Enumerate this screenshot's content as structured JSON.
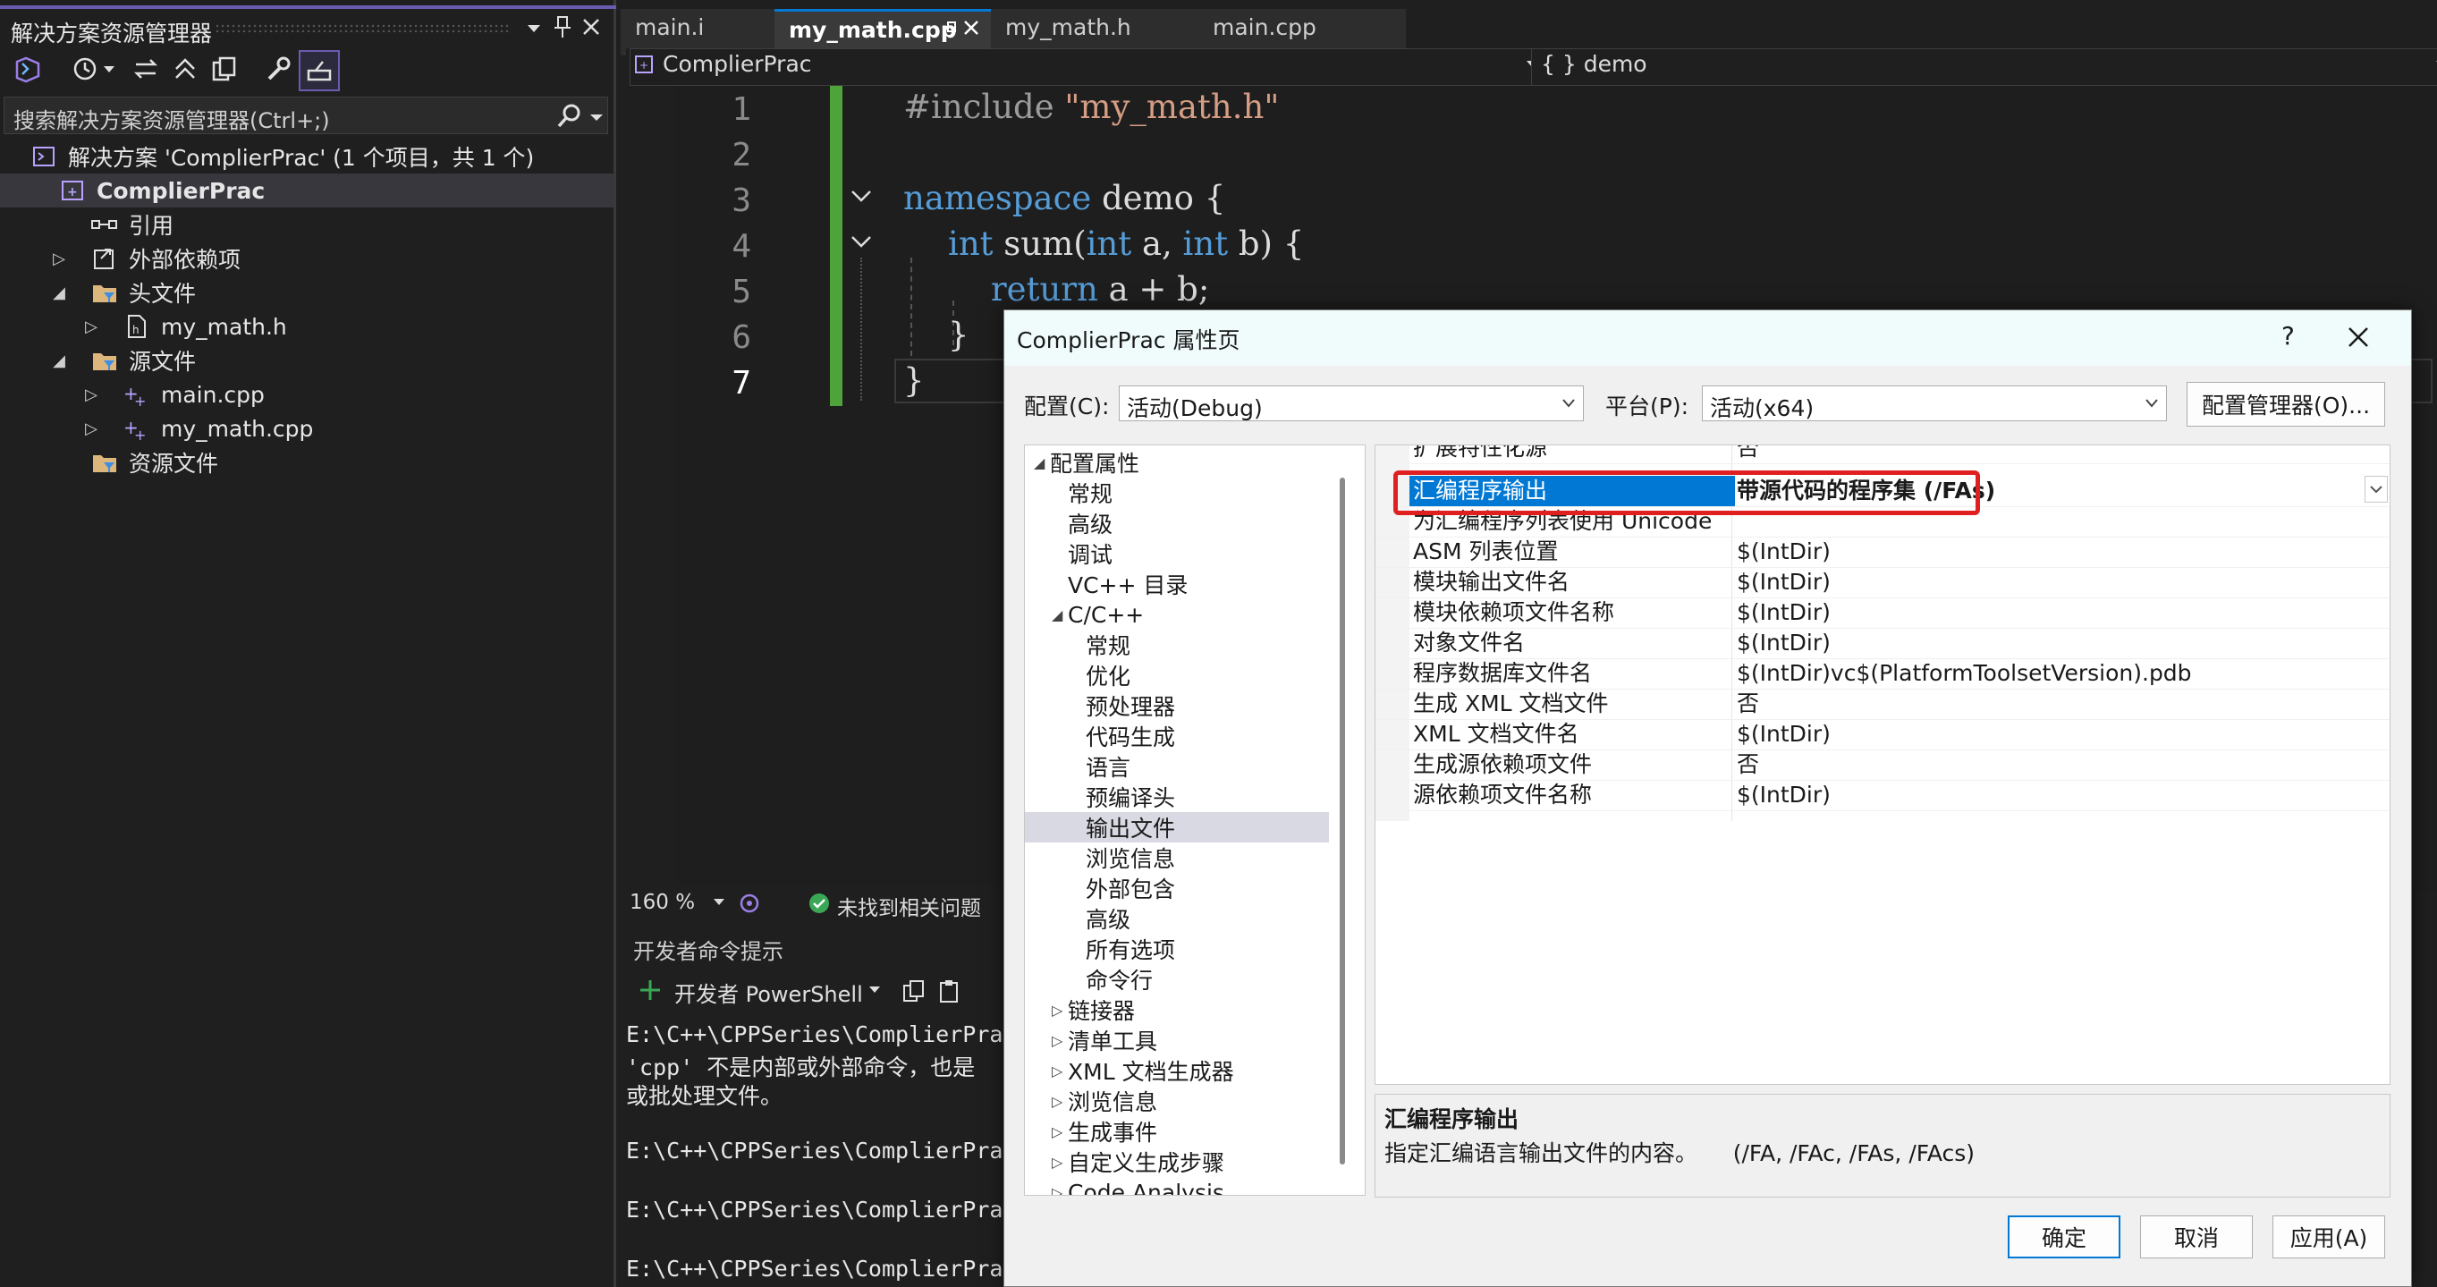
{
  "solution_explorer": {
    "title": "解决方案资源管理器",
    "search_placeholder": "搜索解决方案资源管理器(Ctrl+;)",
    "items": [
      {
        "label": "解决方案 'ComplierPrac' (1 个项目，共 1 个)",
        "icon": "solution-icon"
      },
      {
        "label": "ComplierPrac",
        "icon": "project-icon",
        "bold": true
      },
      {
        "label": "引用",
        "icon": "references-icon"
      },
      {
        "label": "外部依赖项",
        "icon": "external-deps-icon"
      },
      {
        "label": "头文件",
        "icon": "filter-folder-icon"
      },
      {
        "label": "my_math.h",
        "icon": "header-file-icon"
      },
      {
        "label": "源文件",
        "icon": "filter-folder-icon"
      },
      {
        "label": "main.cpp",
        "icon": "cpp-file-icon"
      },
      {
        "label": "my_math.cpp",
        "icon": "cpp-file-icon"
      },
      {
        "label": "资源文件",
        "icon": "filter-folder-icon"
      }
    ]
  },
  "editor": {
    "tabs": [
      {
        "label": "main.i",
        "active": false
      },
      {
        "label": "my_math.cpp",
        "active": true
      },
      {
        "label": "my_math.h",
        "active": false
      },
      {
        "label": "main.cpp",
        "active": false
      }
    ],
    "nav_project": "ComplierPrac",
    "nav_scope": "{ } demo",
    "line_numbers": [
      "1",
      "2",
      "3",
      "4",
      "5",
      "6",
      "7"
    ],
    "lines": {
      "l1_pp": "#include ",
      "l1_str": "\"my_math.h\"",
      "l3_kw": "namespace",
      "l3_rest": " demo {",
      "l4_kw1": "int",
      "l4_a": " sum(",
      "l4_kw2": "int",
      "l4_b": " a, ",
      "l4_kw3": "int",
      "l4_c": " b) {",
      "l5_kw": "return",
      "l5_rest": " a + b;",
      "l6": "}",
      "l7": "}"
    },
    "zoom": "160 %",
    "status": "未找到相关问题"
  },
  "dev_prompt": {
    "title": "开发者命令提示",
    "shell_button": "开发者 PowerShell",
    "lines": [
      "E:\\C++\\CPPSeries\\ComplierPrac",
      "'cpp' 不是内部或外部命令，也是",
      "或批处理文件。",
      "",
      "E:\\C++\\CPPSeries\\ComplierPrac",
      "",
      "E:\\C++\\CPPSeries\\ComplierPrac",
      "",
      "E:\\C++\\CPPSeries\\ComplierPrac"
    ]
  },
  "dialog": {
    "title": "ComplierPrac 属性页",
    "help": "?",
    "config_label": "配置(C):",
    "config_value": "活动(Debug)",
    "platform_label": "平台(P):",
    "platform_value": "活动(x64)",
    "config_manager": "配置管理器(O)...",
    "tree": [
      {
        "label": "配置属性",
        "level": 0,
        "expander": "expanded"
      },
      {
        "label": "常规",
        "level": 1
      },
      {
        "label": "高级",
        "level": 1
      },
      {
        "label": "调试",
        "level": 1
      },
      {
        "label": "VC++ 目录",
        "level": 1
      },
      {
        "label": "C/C++",
        "level": 1,
        "expander": "expanded"
      },
      {
        "label": "常规",
        "level": 2
      },
      {
        "label": "优化",
        "level": 2
      },
      {
        "label": "预处理器",
        "level": 2
      },
      {
        "label": "代码生成",
        "level": 2
      },
      {
        "label": "语言",
        "level": 2
      },
      {
        "label": "预编译头",
        "level": 2
      },
      {
        "label": "输出文件",
        "level": 2,
        "selected": true
      },
      {
        "label": "浏览信息",
        "level": 2
      },
      {
        "label": "外部包含",
        "level": 2
      },
      {
        "label": "高级",
        "level": 2
      },
      {
        "label": "所有选项",
        "level": 2
      },
      {
        "label": "命令行",
        "level": 2
      },
      {
        "label": "链接器",
        "level": 1,
        "expander": "collapsed"
      },
      {
        "label": "清单工具",
        "level": 1,
        "expander": "collapsed"
      },
      {
        "label": "XML 文档生成器",
        "level": 1,
        "expander": "collapsed"
      },
      {
        "label": "浏览信息",
        "level": 1,
        "expander": "collapsed"
      },
      {
        "label": "生成事件",
        "level": 1,
        "expander": "collapsed"
      },
      {
        "label": "自定义生成步骤",
        "level": 1,
        "expander": "collapsed"
      },
      {
        "label": "Code Analysis",
        "level": 1,
        "expander": "collapsed"
      }
    ],
    "properties": [
      {
        "name": "扩展特性化源",
        "value": "否"
      },
      {
        "name": "汇编程序输出",
        "value": "带源代码的程序集 (/FAs)",
        "selected": true
      },
      {
        "name": "为汇编程序列表使用 Unicode",
        "value": ""
      },
      {
        "name": "ASM 列表位置",
        "value": "$(IntDir)"
      },
      {
        "name": "模块输出文件名",
        "value": "$(IntDir)"
      },
      {
        "name": "模块依赖项文件名称",
        "value": "$(IntDir)"
      },
      {
        "name": "对象文件名",
        "value": "$(IntDir)"
      },
      {
        "name": "程序数据库文件名",
        "value": "$(IntDir)vc$(PlatformToolsetVersion).pdb"
      },
      {
        "name": "生成 XML 文档文件",
        "value": "否"
      },
      {
        "name": "XML 文档文件名",
        "value": "$(IntDir)"
      },
      {
        "name": "生成源依赖项文件",
        "value": "否"
      },
      {
        "name": "源依赖项文件名称",
        "value": "$(IntDir)"
      }
    ],
    "desc_title": "汇编程序输出",
    "desc_text": "指定汇编语言输出文件的内容。     (/FA, /FAc, /FAs, /FAcs)",
    "ok": "确定",
    "cancel": "取消",
    "apply": "应用(A)"
  },
  "colors": {
    "highlight_box": "#e02020",
    "selection": "#0078d4",
    "change_bar": "#4ea43a"
  }
}
